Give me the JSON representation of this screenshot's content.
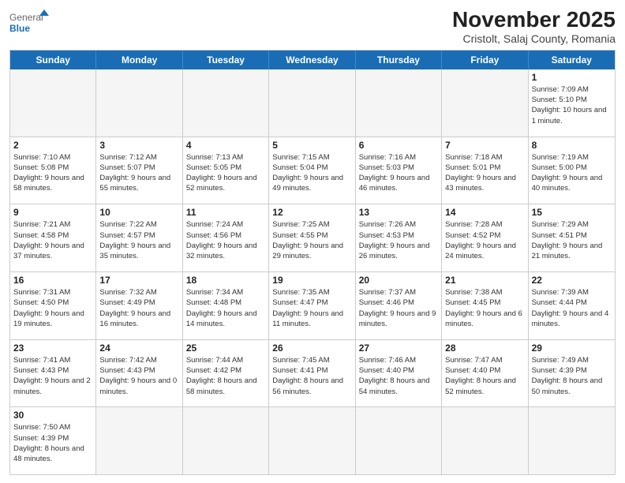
{
  "header": {
    "logo_general": "General",
    "logo_blue": "Blue",
    "month_title": "November 2025",
    "location": "Cristolt, Salaj County, Romania"
  },
  "calendar": {
    "days_of_week": [
      "Sunday",
      "Monday",
      "Tuesday",
      "Wednesday",
      "Thursday",
      "Friday",
      "Saturday"
    ],
    "weeks": [
      [
        {
          "day": "",
          "info": ""
        },
        {
          "day": "",
          "info": ""
        },
        {
          "day": "",
          "info": ""
        },
        {
          "day": "",
          "info": ""
        },
        {
          "day": "",
          "info": ""
        },
        {
          "day": "",
          "info": ""
        },
        {
          "day": "1",
          "info": "Sunrise: 7:09 AM\nSunset: 5:10 PM\nDaylight: 10 hours and 1 minute."
        }
      ],
      [
        {
          "day": "2",
          "info": "Sunrise: 7:10 AM\nSunset: 5:08 PM\nDaylight: 9 hours and 58 minutes."
        },
        {
          "day": "3",
          "info": "Sunrise: 7:12 AM\nSunset: 5:07 PM\nDaylight: 9 hours and 55 minutes."
        },
        {
          "day": "4",
          "info": "Sunrise: 7:13 AM\nSunset: 5:05 PM\nDaylight: 9 hours and 52 minutes."
        },
        {
          "day": "5",
          "info": "Sunrise: 7:15 AM\nSunset: 5:04 PM\nDaylight: 9 hours and 49 minutes."
        },
        {
          "day": "6",
          "info": "Sunrise: 7:16 AM\nSunset: 5:03 PM\nDaylight: 9 hours and 46 minutes."
        },
        {
          "day": "7",
          "info": "Sunrise: 7:18 AM\nSunset: 5:01 PM\nDaylight: 9 hours and 43 minutes."
        },
        {
          "day": "8",
          "info": "Sunrise: 7:19 AM\nSunset: 5:00 PM\nDaylight: 9 hours and 40 minutes."
        }
      ],
      [
        {
          "day": "9",
          "info": "Sunrise: 7:21 AM\nSunset: 4:58 PM\nDaylight: 9 hours and 37 minutes."
        },
        {
          "day": "10",
          "info": "Sunrise: 7:22 AM\nSunset: 4:57 PM\nDaylight: 9 hours and 35 minutes."
        },
        {
          "day": "11",
          "info": "Sunrise: 7:24 AM\nSunset: 4:56 PM\nDaylight: 9 hours and 32 minutes."
        },
        {
          "day": "12",
          "info": "Sunrise: 7:25 AM\nSunset: 4:55 PM\nDaylight: 9 hours and 29 minutes."
        },
        {
          "day": "13",
          "info": "Sunrise: 7:26 AM\nSunset: 4:53 PM\nDaylight: 9 hours and 26 minutes."
        },
        {
          "day": "14",
          "info": "Sunrise: 7:28 AM\nSunset: 4:52 PM\nDaylight: 9 hours and 24 minutes."
        },
        {
          "day": "15",
          "info": "Sunrise: 7:29 AM\nSunset: 4:51 PM\nDaylight: 9 hours and 21 minutes."
        }
      ],
      [
        {
          "day": "16",
          "info": "Sunrise: 7:31 AM\nSunset: 4:50 PM\nDaylight: 9 hours and 19 minutes."
        },
        {
          "day": "17",
          "info": "Sunrise: 7:32 AM\nSunset: 4:49 PM\nDaylight: 9 hours and 16 minutes."
        },
        {
          "day": "18",
          "info": "Sunrise: 7:34 AM\nSunset: 4:48 PM\nDaylight: 9 hours and 14 minutes."
        },
        {
          "day": "19",
          "info": "Sunrise: 7:35 AM\nSunset: 4:47 PM\nDaylight: 9 hours and 11 minutes."
        },
        {
          "day": "20",
          "info": "Sunrise: 7:37 AM\nSunset: 4:46 PM\nDaylight: 9 hours and 9 minutes."
        },
        {
          "day": "21",
          "info": "Sunrise: 7:38 AM\nSunset: 4:45 PM\nDaylight: 9 hours and 6 minutes."
        },
        {
          "day": "22",
          "info": "Sunrise: 7:39 AM\nSunset: 4:44 PM\nDaylight: 9 hours and 4 minutes."
        }
      ],
      [
        {
          "day": "23",
          "info": "Sunrise: 7:41 AM\nSunset: 4:43 PM\nDaylight: 9 hours and 2 minutes."
        },
        {
          "day": "24",
          "info": "Sunrise: 7:42 AM\nSunset: 4:43 PM\nDaylight: 9 hours and 0 minutes."
        },
        {
          "day": "25",
          "info": "Sunrise: 7:44 AM\nSunset: 4:42 PM\nDaylight: 8 hours and 58 minutes."
        },
        {
          "day": "26",
          "info": "Sunrise: 7:45 AM\nSunset: 4:41 PM\nDaylight: 8 hours and 56 minutes."
        },
        {
          "day": "27",
          "info": "Sunrise: 7:46 AM\nSunset: 4:40 PM\nDaylight: 8 hours and 54 minutes."
        },
        {
          "day": "28",
          "info": "Sunrise: 7:47 AM\nSunset: 4:40 PM\nDaylight: 8 hours and 52 minutes."
        },
        {
          "day": "29",
          "info": "Sunrise: 7:49 AM\nSunset: 4:39 PM\nDaylight: 8 hours and 50 minutes."
        }
      ],
      [
        {
          "day": "30",
          "info": "Sunrise: 7:50 AM\nSunset: 4:39 PM\nDaylight: 8 hours and 48 minutes."
        },
        {
          "day": "",
          "info": ""
        },
        {
          "day": "",
          "info": ""
        },
        {
          "day": "",
          "info": ""
        },
        {
          "day": "",
          "info": ""
        },
        {
          "day": "",
          "info": ""
        },
        {
          "day": "",
          "info": ""
        }
      ]
    ]
  }
}
